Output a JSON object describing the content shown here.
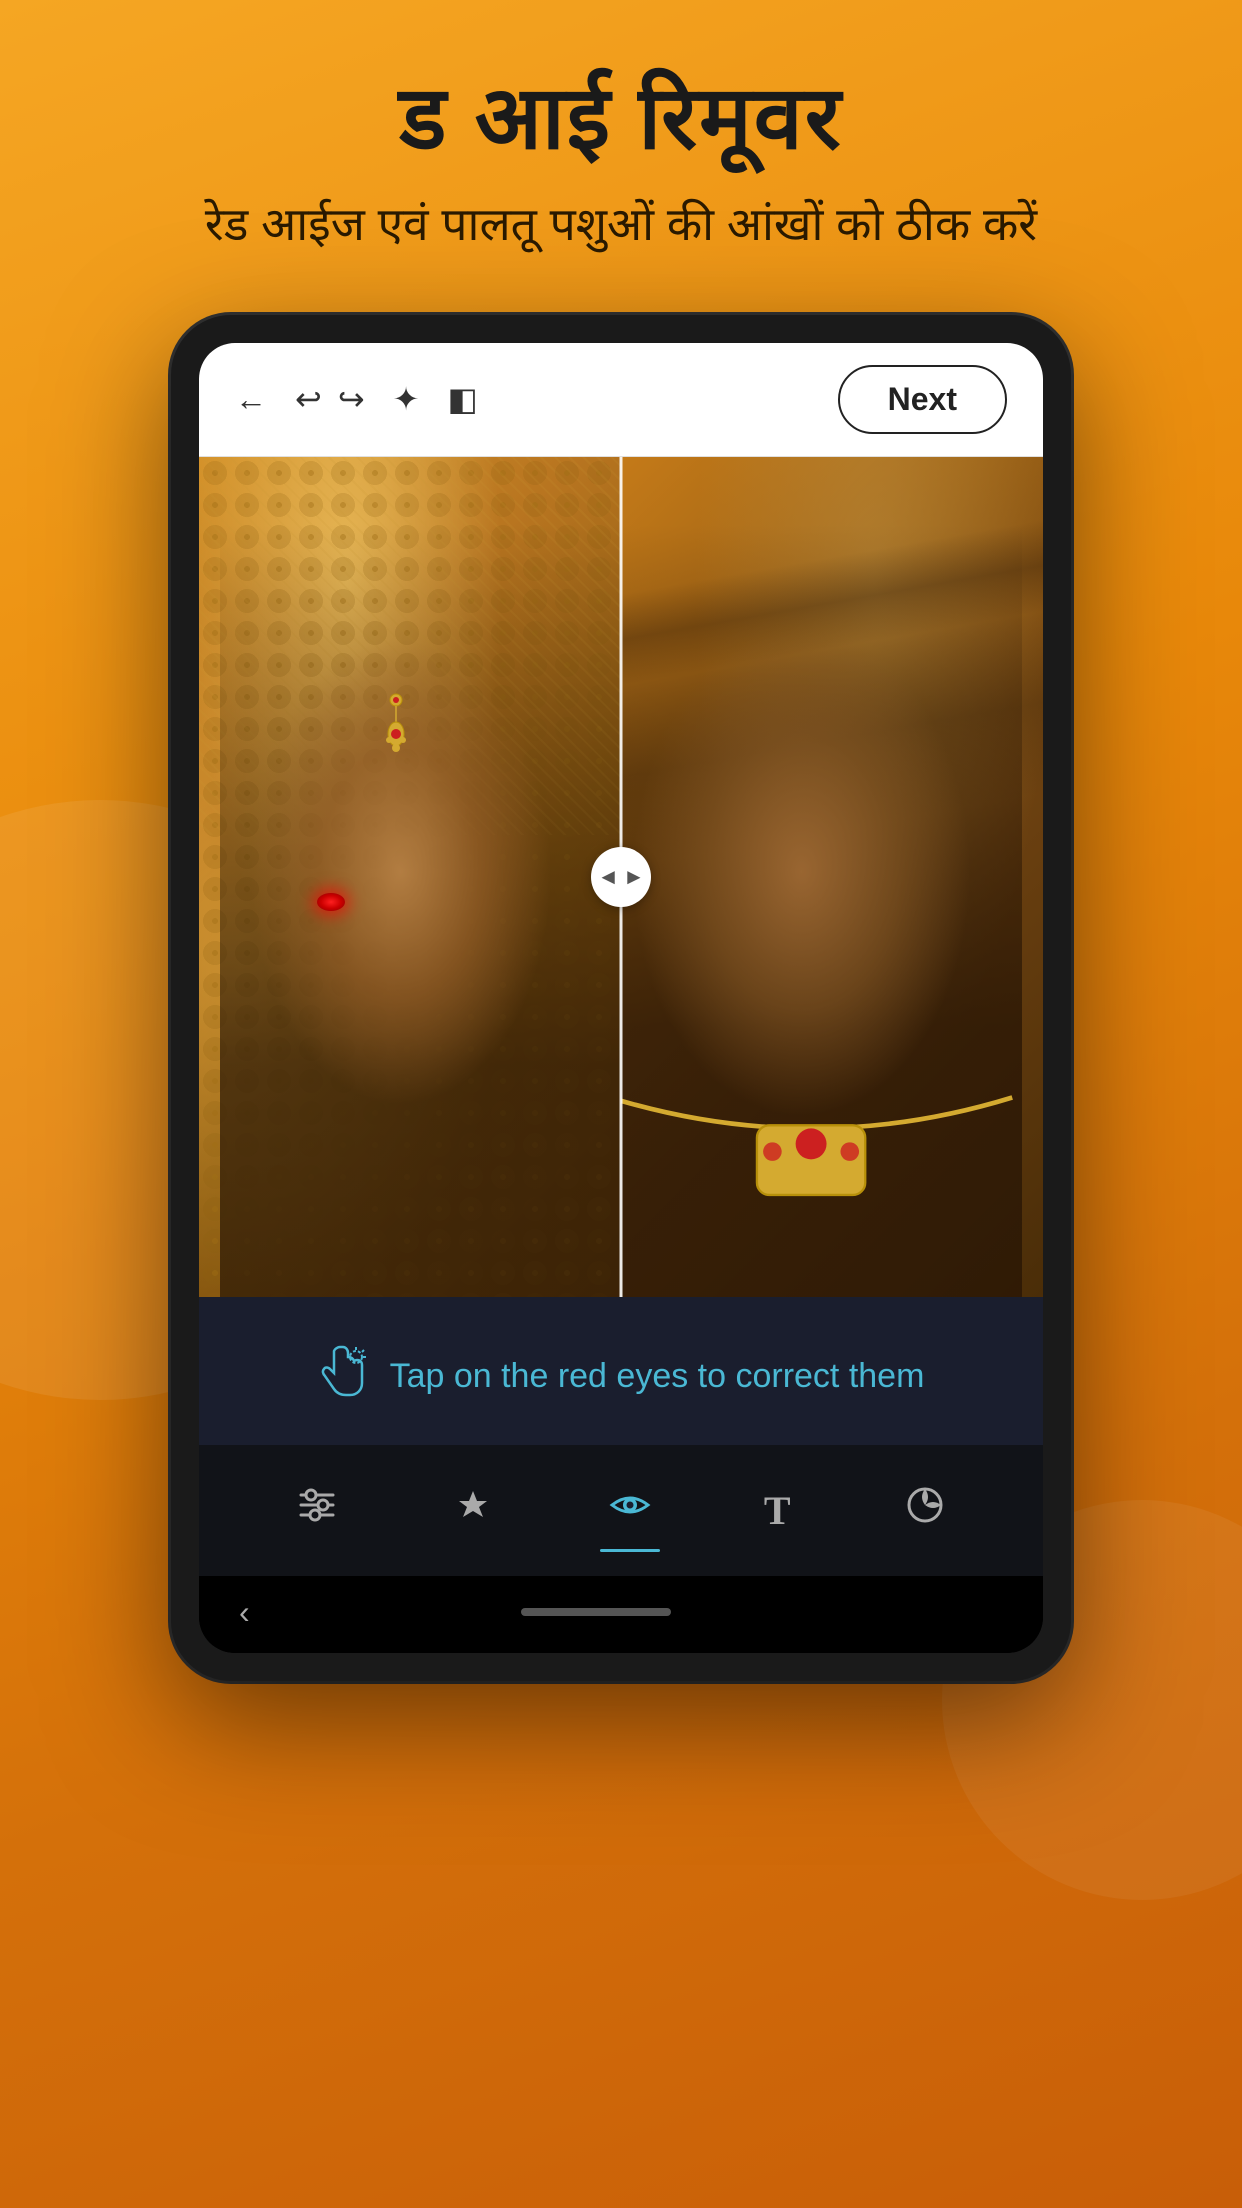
{
  "app": {
    "title": "ड आई रिमूवर",
    "subtitle": "रेड आईज एवं पालतू पशुओं की आंखों को ठीक करें"
  },
  "toolbar": {
    "back_icon": "←",
    "undo_icon": "↩",
    "redo_icon": "↪",
    "magic_icon": "✦",
    "compare_icon": "◧",
    "next_label": "Next"
  },
  "instruction": {
    "icon": "👆",
    "text": "Tap on the red eyes to correct them"
  },
  "tools": [
    {
      "name": "adjust",
      "icon": "⊟",
      "label": "Adjust",
      "active": false
    },
    {
      "name": "heal",
      "icon": "✦",
      "label": "Heal",
      "active": false
    },
    {
      "name": "red-eye",
      "icon": "👁",
      "label": "Red Eye",
      "active": true
    },
    {
      "name": "text",
      "icon": "T",
      "label": "Text",
      "active": false
    },
    {
      "name": "retouch",
      "icon": "↺",
      "label": "Retouch",
      "active": false
    }
  ],
  "nav": {
    "back_icon": "‹"
  },
  "colors": {
    "background_orange": "#f5a623",
    "toolbar_bg": "#ffffff",
    "next_btn_border": "#222222",
    "instruction_panel_bg": "#1a1e2e",
    "instruction_text": "#4ab8d4",
    "bottom_toolbar_bg": "#111318",
    "active_tool": "#4ab8d4",
    "inactive_tool": "#aaaaaa"
  }
}
